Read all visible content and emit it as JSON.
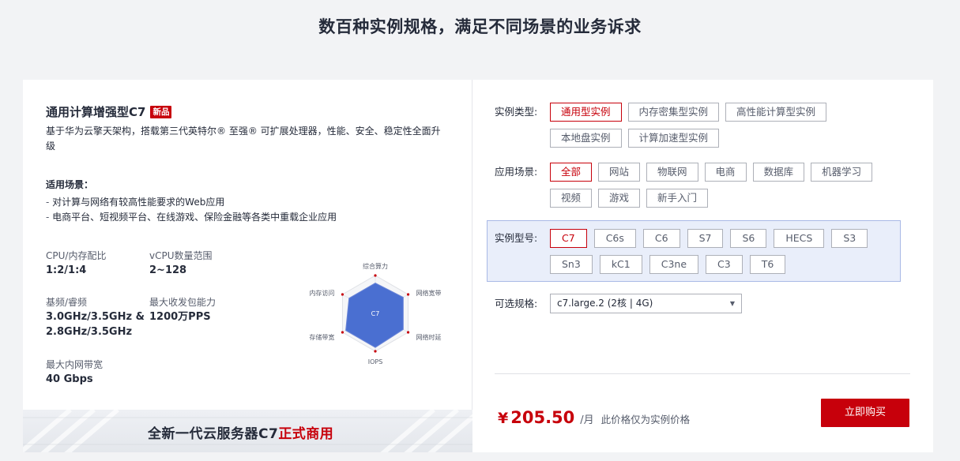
{
  "page": {
    "title": "数百种实例规格，满足不同场景的业务诉求"
  },
  "product": {
    "name": "通用计算增强型C7",
    "badge": "新品",
    "description": "基于华为云擎天架构，搭载第三代英特尔® 至强® 可扩展处理器，性能、安全、稳定性全面升级",
    "scenes_title": "适用场景：",
    "scenes": [
      "对计算与网络有较高性能要求的Web应用",
      "电商平台、短视频平台、在线游戏、保险金融等各类中重载企业应用"
    ],
    "specs": [
      {
        "label": "CPU/内存配比",
        "value": "1:2/1:4"
      },
      {
        "label": "vCPU数量范围",
        "value": "2~128"
      },
      {
        "label": "基频/睿频",
        "value": "3.0GHz/3.5GHz &\n2.8GHz/3.5GHz"
      },
      {
        "label": "最大收发包能力",
        "value": "1200万PPS"
      },
      {
        "label": "最大内网带宽",
        "value": "40 Gbps"
      }
    ],
    "radar": {
      "center_label": "C7",
      "axes": [
        "综合算力",
        "网络宽带",
        "网络时延",
        "IOPS",
        "存储带宽",
        "内存访问"
      ],
      "values": [
        0.8,
        0.85,
        0.85,
        0.9,
        0.9,
        0.8
      ],
      "fill_color": "#4a6fd1",
      "accent_color": "#c7000b"
    }
  },
  "banner": {
    "text_main": "全新一代云服务器C7",
    "text_highlight": "正式商用"
  },
  "filters": {
    "instance_type": {
      "label": "实例类型:",
      "options": [
        "通用型实例",
        "内存密集型实例",
        "高性能计算型实例",
        "本地盘实例",
        "计算加速型实例"
      ],
      "selected": "通用型实例"
    },
    "scenario": {
      "label": "应用场景:",
      "options": [
        "全部",
        "网站",
        "物联网",
        "电商",
        "数据库",
        "机器学习",
        "视频",
        "游戏",
        "新手入门"
      ],
      "selected": "全部"
    },
    "model": {
      "label": "实例型号:",
      "options": [
        "C7",
        "C6s",
        "C6",
        "S7",
        "S6",
        "HECS",
        "S3",
        "Sn3",
        "kC1",
        "C3ne",
        "C3",
        "T6"
      ],
      "selected": "C7"
    },
    "flavor": {
      "label": "可选规格:",
      "value": "c7.large.2 (2核 | 4G)"
    }
  },
  "price": {
    "currency": "¥",
    "amount": "205.50",
    "unit": "/月",
    "note": "此价格仅为实例价格",
    "buy_label": "立即购买"
  },
  "colors": {
    "brand_red": "#c7000b",
    "model_box_bg": "#e9eefa"
  }
}
